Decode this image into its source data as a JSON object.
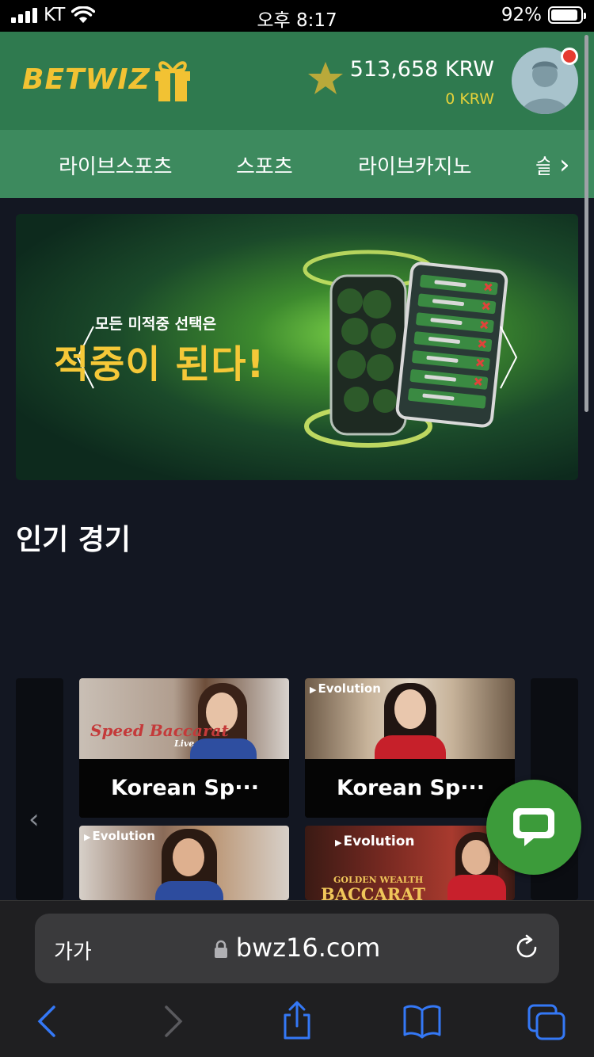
{
  "status_bar": {
    "carrier": "KT",
    "time": "오후 8:17",
    "battery": "92%",
    "battery_level": 0.92
  },
  "header": {
    "logo": "BETWIZ",
    "balance": "513,658 KRW",
    "bonus_balance": "0 KRW",
    "icons": [
      "gift-icon",
      "star-icon",
      "avatar-icon"
    ],
    "colors": {
      "header_bg": "#2f7a4f",
      "nav_bg": "#3d8a5e",
      "logo": "#f2c233",
      "bonus": "#e6d23a",
      "notification": "#e63b30"
    }
  },
  "nav": {
    "items": [
      {
        "label": "라이브스포츠"
      },
      {
        "label": "스포츠"
      },
      {
        "label": "라이브카지노"
      },
      {
        "label": "슬"
      }
    ]
  },
  "banner": {
    "subtitle": "모든 미적중 선택은",
    "headline": "적중이 된다!",
    "headline_color": "#f5c838"
  },
  "popular": {
    "title": "인기 경기",
    "games": [
      {
        "label": "Korean Sp···",
        "thumb_text": "Speed Baccarat",
        "thumb_sub": "Live"
      },
      {
        "label": "Korean Sp···",
        "thumb_text": "Evolution"
      },
      {
        "label": "",
        "thumb_text": "Evolution"
      },
      {
        "label": "",
        "thumb_text": "Evolution",
        "thumb_sub": "GOLDEN WEALTH",
        "thumb_big": "BACCARAT"
      }
    ]
  },
  "safari": {
    "text_size": "가가",
    "url": "bwz16.com",
    "accent": "#3478f6"
  }
}
